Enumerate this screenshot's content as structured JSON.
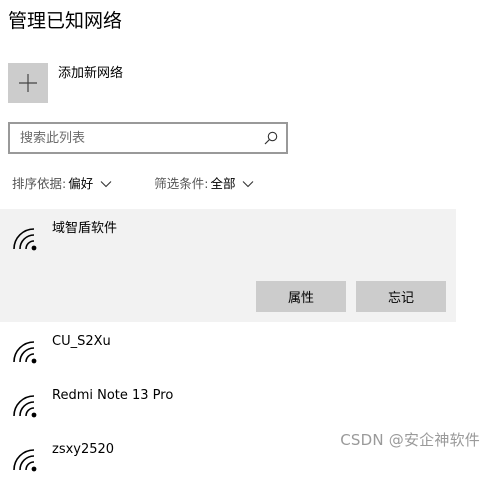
{
  "page": {
    "title": "管理已知网络"
  },
  "add_network": {
    "label": "添加新网络",
    "icon": "plus-icon"
  },
  "search": {
    "placeholder": "搜索此列表",
    "value": "",
    "icon": "search-icon"
  },
  "sort": {
    "label": "排序依据:",
    "value": "偏好"
  },
  "filter": {
    "label": "筛选条件:",
    "value": "全部"
  },
  "networks": [
    {
      "name": "域智盾软件",
      "selected": true,
      "icon": "wifi-icon",
      "actions": {
        "properties": "属性",
        "forget": "忘记"
      }
    },
    {
      "name": "CU_S2Xu",
      "selected": false,
      "icon": "wifi-icon"
    },
    {
      "name": "Redmi Note 13 Pro",
      "selected": false,
      "icon": "wifi-icon"
    },
    {
      "name": "zsxy2520",
      "selected": false,
      "icon": "wifi-icon"
    }
  ],
  "watermark": "CSDN @安企神软件",
  "colors": {
    "tile": "#cccccc",
    "selected_row": "#f2f2f2",
    "search_border": "#999999",
    "watermark": "#9a9a9a"
  }
}
